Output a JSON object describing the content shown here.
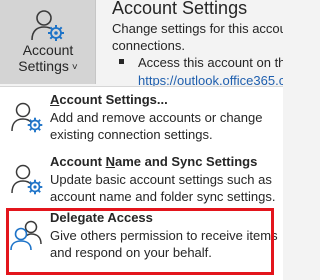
{
  "ribbon": {
    "button": {
      "label_line1": "Account",
      "label_line2": "Settings",
      "icon": "account-settings-icon",
      "chevron": "˅"
    },
    "info": {
      "title": "Account Settings",
      "desc_line1": "Change settings for this account or set up more",
      "desc_line2": "connections.",
      "bullet_text": "Access this account on the web.",
      "link_text": "https://outlook.office365.com/owa/"
    }
  },
  "menu": {
    "items": [
      {
        "title_pre": "",
        "title_u": "A",
        "title_post": "ccount Settings...",
        "desc": "Add and remove accounts or change existing connection settings.",
        "icon": "account-settings-icon"
      },
      {
        "title_pre": "Account ",
        "title_u": "N",
        "title_post": "ame and Sync Settings",
        "desc": "Update basic account settings such as account name and folder sync settings.",
        "icon": "account-settings-icon"
      },
      {
        "title_pre": "Dele",
        "title_u": "g",
        "title_post": "ate Access",
        "desc": "Give others permission to receive items and respond on your behalf.",
        "icon": "delegate-people-icon"
      }
    ]
  },
  "colors": {
    "highlight": "#e3151c",
    "accent_blue": "#1d73c8",
    "link": "#1f5fae"
  }
}
